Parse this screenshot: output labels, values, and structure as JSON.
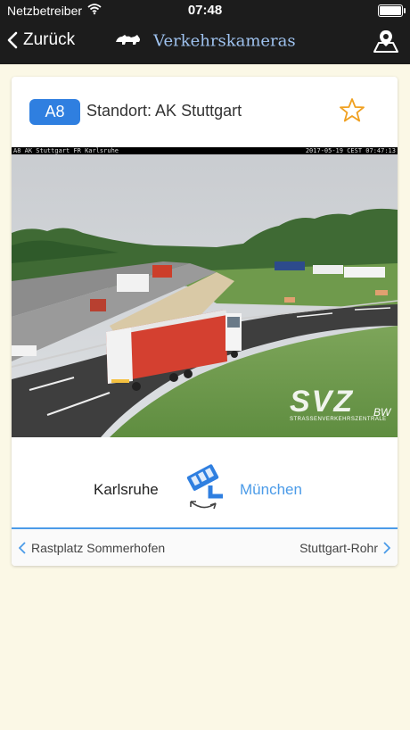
{
  "status_bar": {
    "carrier": "Netzbetreiber",
    "time": "07:48"
  },
  "nav": {
    "back_label": "Zurück",
    "title": "Verkehrskameras"
  },
  "camera": {
    "road_badge": "A8",
    "location": "Standort: AK Stuttgart",
    "overlay_left": "A8 AK Stuttgart FR Karlsruhe",
    "overlay_right": "2017-05-19 CEST 07:47:13",
    "logo_text": "SVZ",
    "logo_subtext": "STRASSENVERKEHRSZENTRALE",
    "logo_region": "BW"
  },
  "direction": {
    "from": "Karlsruhe",
    "to": "München"
  },
  "footer": {
    "previous": "Rastplatz Sommerhofen",
    "next": "Stuttgart-Rohr"
  },
  "colors": {
    "accent": "#4b9be8",
    "badge": "#2f7fe0",
    "star": "#f0a020",
    "background": "#fbf8e6",
    "bar": "#1c1c1c"
  },
  "icons": [
    "chevron-left-icon",
    "wifi-icon",
    "battery-icon",
    "map-pin-icon",
    "star-icon",
    "camera-switch-icon",
    "chevron-right-icon"
  ]
}
